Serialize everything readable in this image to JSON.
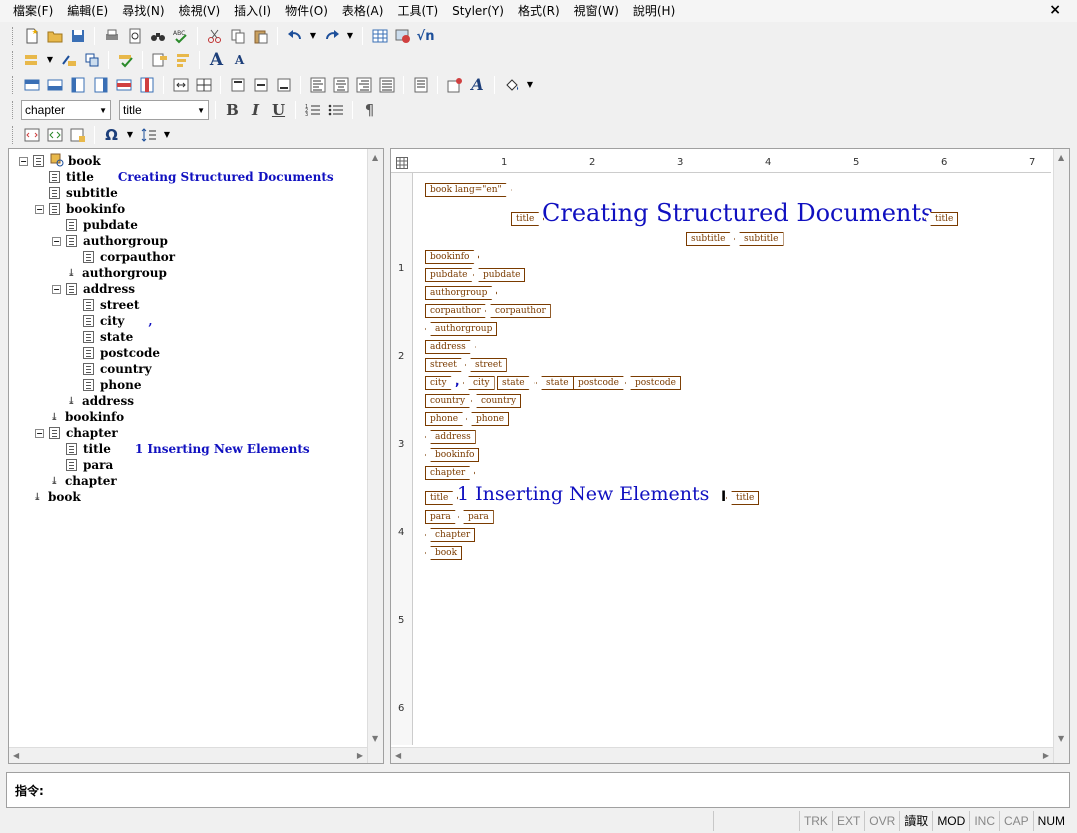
{
  "menu": {
    "items": [
      "檔案(F)",
      "編輯(E)",
      "尋找(N)",
      "檢視(V)",
      "插入(I)",
      "物件(O)",
      "表格(A)",
      "工具(T)",
      "Styler(Y)",
      "格式(R)",
      "視窗(W)",
      "說明(H)"
    ],
    "close": "×"
  },
  "toolbar": {
    "element_select": "chapter",
    "style_select": "title",
    "bold": "B",
    "italic": "I",
    "underline": "U",
    "pilcrow": "¶",
    "font_up": "A",
    "font_down": "A",
    "omega": "Ω",
    "sqrt": "√n"
  },
  "tree": {
    "rows": [
      {
        "label": "book"
      },
      {
        "label": "title",
        "content": "Creating Structured Documents"
      },
      {
        "label": "subtitle"
      },
      {
        "label": "bookinfo"
      },
      {
        "label": "pubdate"
      },
      {
        "label": "authorgroup"
      },
      {
        "label": "corpauthor"
      },
      {
        "label": "authorgroup"
      },
      {
        "label": "address"
      },
      {
        "label": "street"
      },
      {
        "label": "city",
        "content": ","
      },
      {
        "label": "state"
      },
      {
        "label": "postcode"
      },
      {
        "label": "country"
      },
      {
        "label": "phone"
      },
      {
        "label": "address"
      },
      {
        "label": "bookinfo"
      },
      {
        "label": "chapter"
      },
      {
        "label": "title",
        "content": "1   Inserting New Elements"
      },
      {
        "label": "para"
      },
      {
        "label": "chapter"
      },
      {
        "label": "book"
      }
    ]
  },
  "ruler": {
    "top": [
      "1",
      "2",
      "3",
      "4",
      "5",
      "6",
      "7"
    ],
    "left": [
      "1",
      "2",
      "3",
      "4",
      "5",
      "6"
    ]
  },
  "document": {
    "book_open": "book lang=\"en\"",
    "title_text": "Creating Structured Documents",
    "chapter_title_text": "1   Inserting New Elements",
    "comma": ",",
    "tags": {
      "title": "title",
      "subtitle": "subtitle",
      "bookinfo": "bookinfo",
      "pubdate": "pubdate",
      "authorgroup": "authorgroup",
      "corpauthor": "corpauthor",
      "address": "address",
      "street": "street",
      "city": "city",
      "state": "state",
      "postcode": "postcode",
      "country": "country",
      "phone": "phone",
      "chapter": "chapter",
      "para": "para",
      "book": "book"
    }
  },
  "command": {
    "label": "指令:"
  },
  "status": {
    "cells": [
      "TRK",
      "EXT",
      "OVR",
      "讀取",
      "MOD",
      "INC",
      "CAP",
      "NUM"
    ]
  },
  "colors": {
    "tag_border": "#7a3b00",
    "content_blue": "#1010c0"
  }
}
